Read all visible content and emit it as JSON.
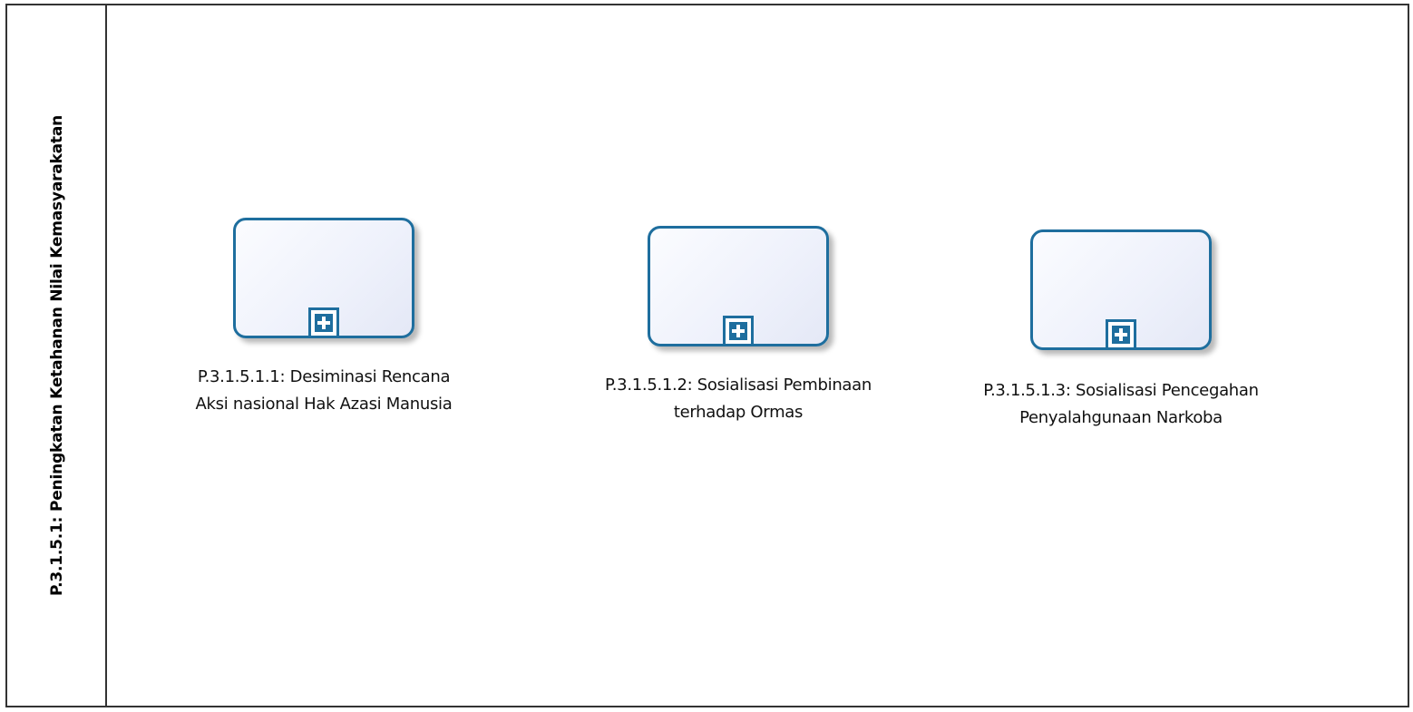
{
  "pool": {
    "title": "P.3.1.5.1: Peningkatan Ketahanan Nilai Kemasyarakatan"
  },
  "tasks": [
    {
      "label_line1": "P.3.1.5.1.1: Desiminasi Rencana",
      "label_line2": "Aksi nasional Hak Azasi Manusia",
      "marker": "plus-icon"
    },
    {
      "label_line1": "P.3.1.5.1.2: Sosialisasi Pembinaan",
      "label_line2": "terhadap Ormas",
      "marker": "plus-icon"
    },
    {
      "label_line1": "P.3.1.5.1.3: Sosialisasi Pencegahan",
      "label_line2": "Penyalahgunaan Narkoba",
      "marker": "plus-icon"
    }
  ],
  "colors": {
    "task_border": "#1e6e9e",
    "pool_border": "#333333"
  }
}
